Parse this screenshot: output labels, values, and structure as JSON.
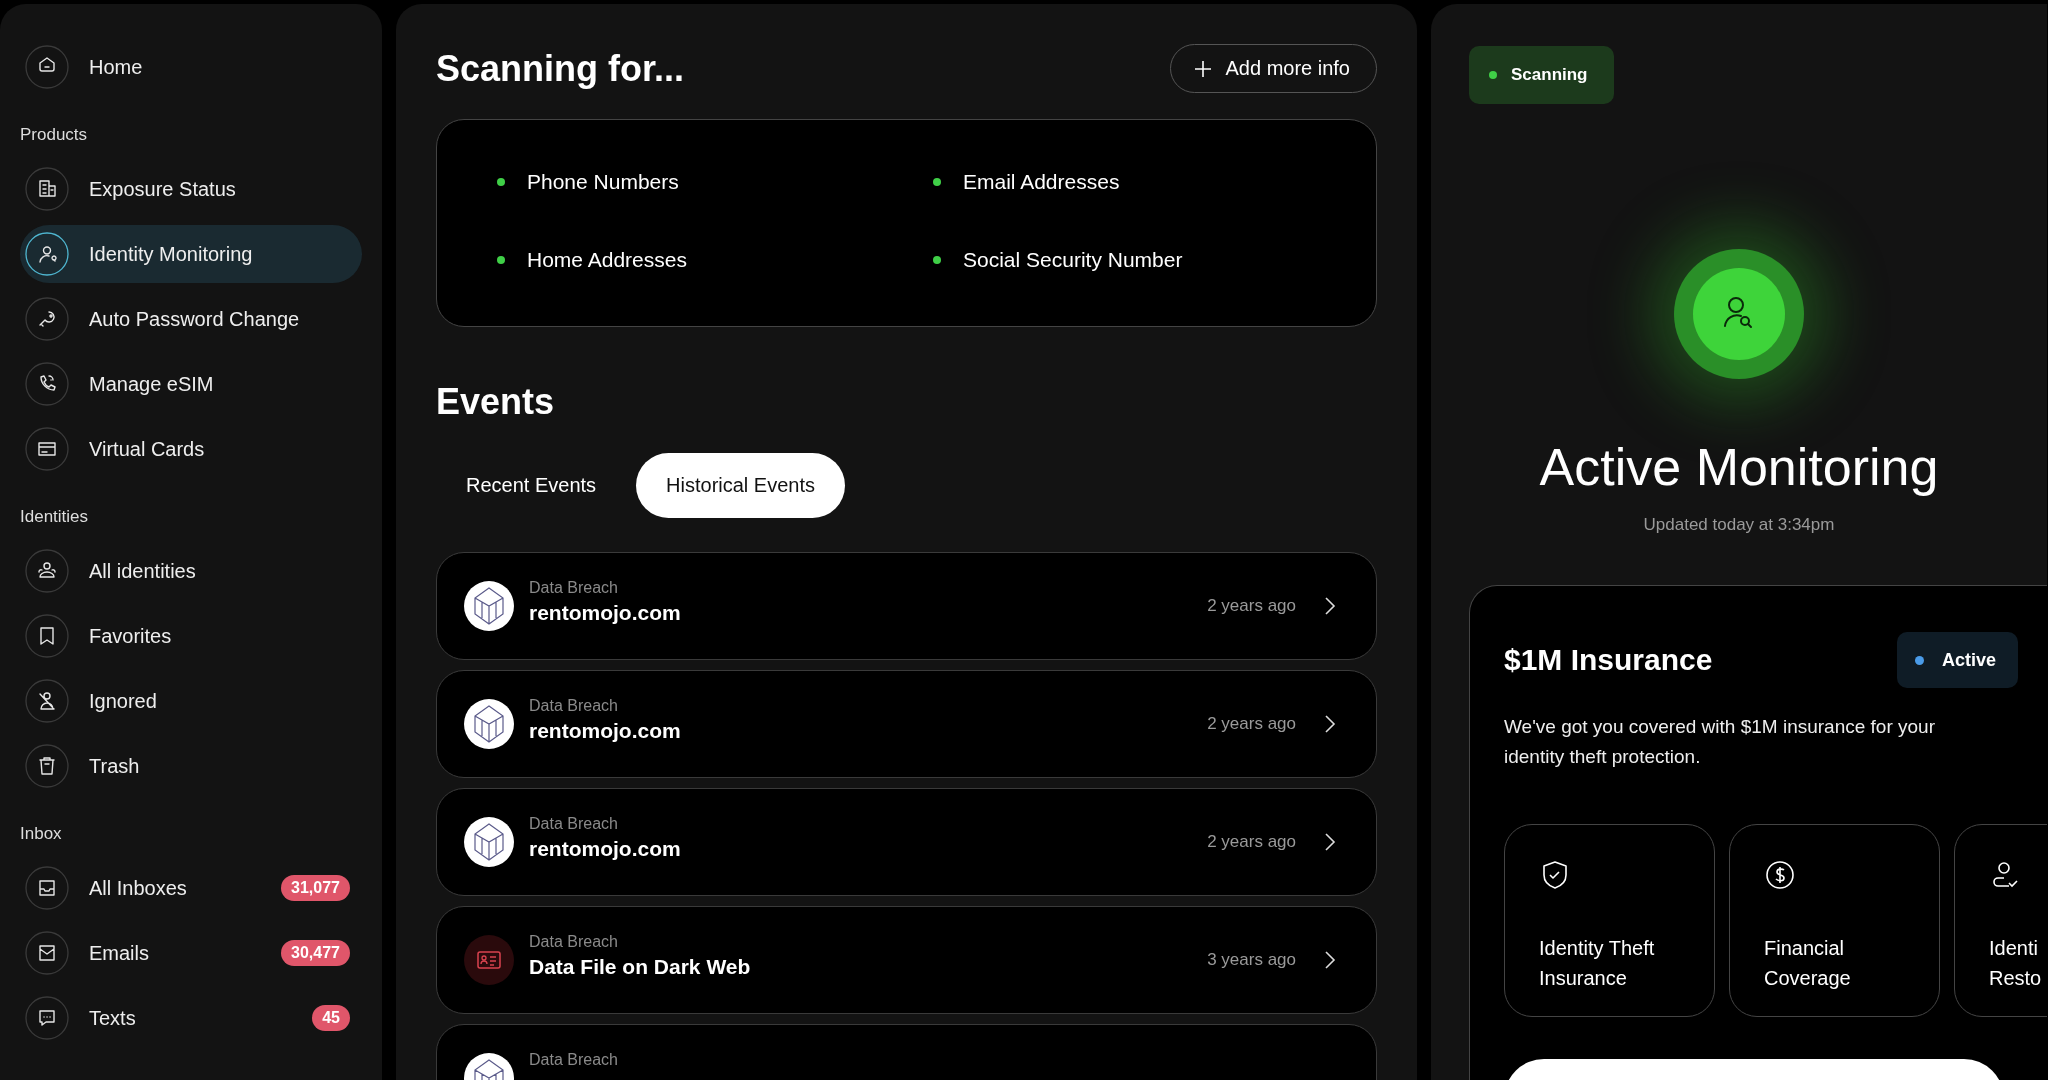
{
  "sidebar": {
    "top_items": [
      {
        "label": "Home",
        "selected": false
      }
    ],
    "sections": [
      {
        "title": "Products",
        "items": [
          {
            "label": "Exposure Status",
            "selected": false
          },
          {
            "label": "Identity Monitoring",
            "selected": true
          },
          {
            "label": "Auto Password Change",
            "selected": false
          },
          {
            "label": "Manage eSIM",
            "selected": false
          },
          {
            "label": "Virtual Cards",
            "selected": false
          }
        ]
      },
      {
        "title": "Identities",
        "items": [
          {
            "label": "All identities",
            "selected": false
          },
          {
            "label": "Favorites",
            "selected": false
          },
          {
            "label": "Ignored",
            "selected": false
          },
          {
            "label": "Trash",
            "selected": false
          }
        ]
      },
      {
        "title": "Inbox",
        "items": [
          {
            "label": "All Inboxes",
            "selected": false,
            "badge": "31,077"
          },
          {
            "label": "Emails",
            "selected": false,
            "badge": "30,477"
          },
          {
            "label": "Texts",
            "selected": false,
            "badge": "45"
          }
        ]
      }
    ]
  },
  "scanning": {
    "title": "Scanning for...",
    "add_button": "Add more info",
    "items": [
      "Phone Numbers",
      "Email Addresses",
      "Home Addresses",
      "Social Security Number"
    ]
  },
  "events": {
    "title": "Events",
    "tabs": [
      {
        "label": "Recent Events",
        "selected": false
      },
      {
        "label": "Historical Events",
        "selected": true
      }
    ],
    "rows": [
      {
        "kind": "logo",
        "category": "Data Breach",
        "name": "rentomojo.com",
        "time": "2 years ago"
      },
      {
        "kind": "logo",
        "category": "Data Breach",
        "name": "rentomojo.com",
        "time": "2 years ago"
      },
      {
        "kind": "logo",
        "category": "Data Breach",
        "name": "rentomojo.com",
        "time": "2 years ago"
      },
      {
        "kind": "dark-web",
        "category": "Data Breach",
        "name": "Data File on Dark Web",
        "time": "3 years ago"
      },
      {
        "kind": "logo",
        "category": "Data Breach"
      }
    ]
  },
  "monitor": {
    "status": "Scanning",
    "title": "Active Monitoring",
    "updated": "Updated today at 3:34pm",
    "insurance": {
      "title": "$1M Insurance",
      "status": "Active",
      "description": "We've got you covered with $1M insurance for your identity theft protection.",
      "features": [
        {
          "kind": "shield",
          "lines": [
            "Identity Theft",
            "Insurance"
          ]
        },
        {
          "kind": "dollar",
          "lines": [
            "Financial",
            "Coverage"
          ]
        },
        {
          "kind": "person",
          "lines": [
            "Identi",
            "Resto"
          ]
        }
      ]
    }
  }
}
